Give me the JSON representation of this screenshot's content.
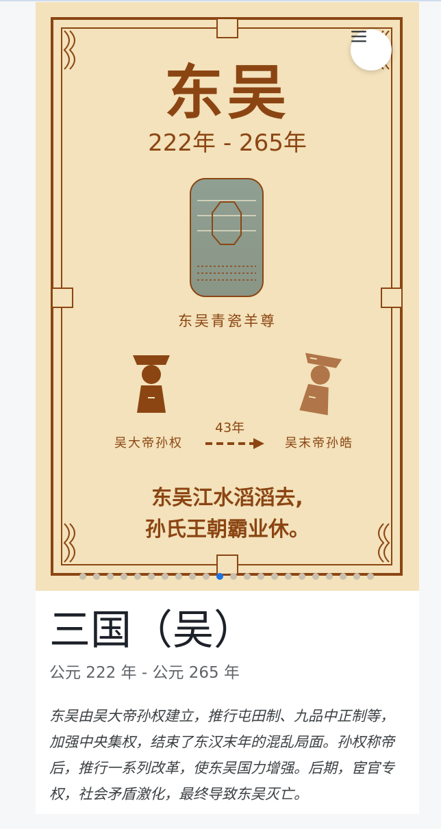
{
  "poster": {
    "title": "东吴",
    "years": "222年 - 265年",
    "artifact_label": "东吴青瓷羊尊",
    "emperor_first": "吴大帝孙权",
    "emperor_last": "吴末帝孙皓",
    "span_label": "43年",
    "poem_line1": "东吴江水滔滔去,",
    "poem_line2": "孙氏王朝霸业休。",
    "colors": {
      "background": "#f3e2bb",
      "ink": "#8b4513",
      "celadon": "#8a9c8c"
    }
  },
  "menu": {
    "icon": "hamburger-menu-icon"
  },
  "carousel": {
    "count": 22,
    "active_index": 10
  },
  "info": {
    "title": "三国（吴）",
    "period": "公元 222 年 - 公元 265 年",
    "description": "东吴由吴大帝孙权建立，推行屯田制、九品中正制等，加强中央集权，结束了东汉末年的混乱局面。孙权称帝后，推行一系列改革，使东吴国力增强。后期，宦官专权，社会矛盾激化，最终导致东吴灭亡。"
  }
}
